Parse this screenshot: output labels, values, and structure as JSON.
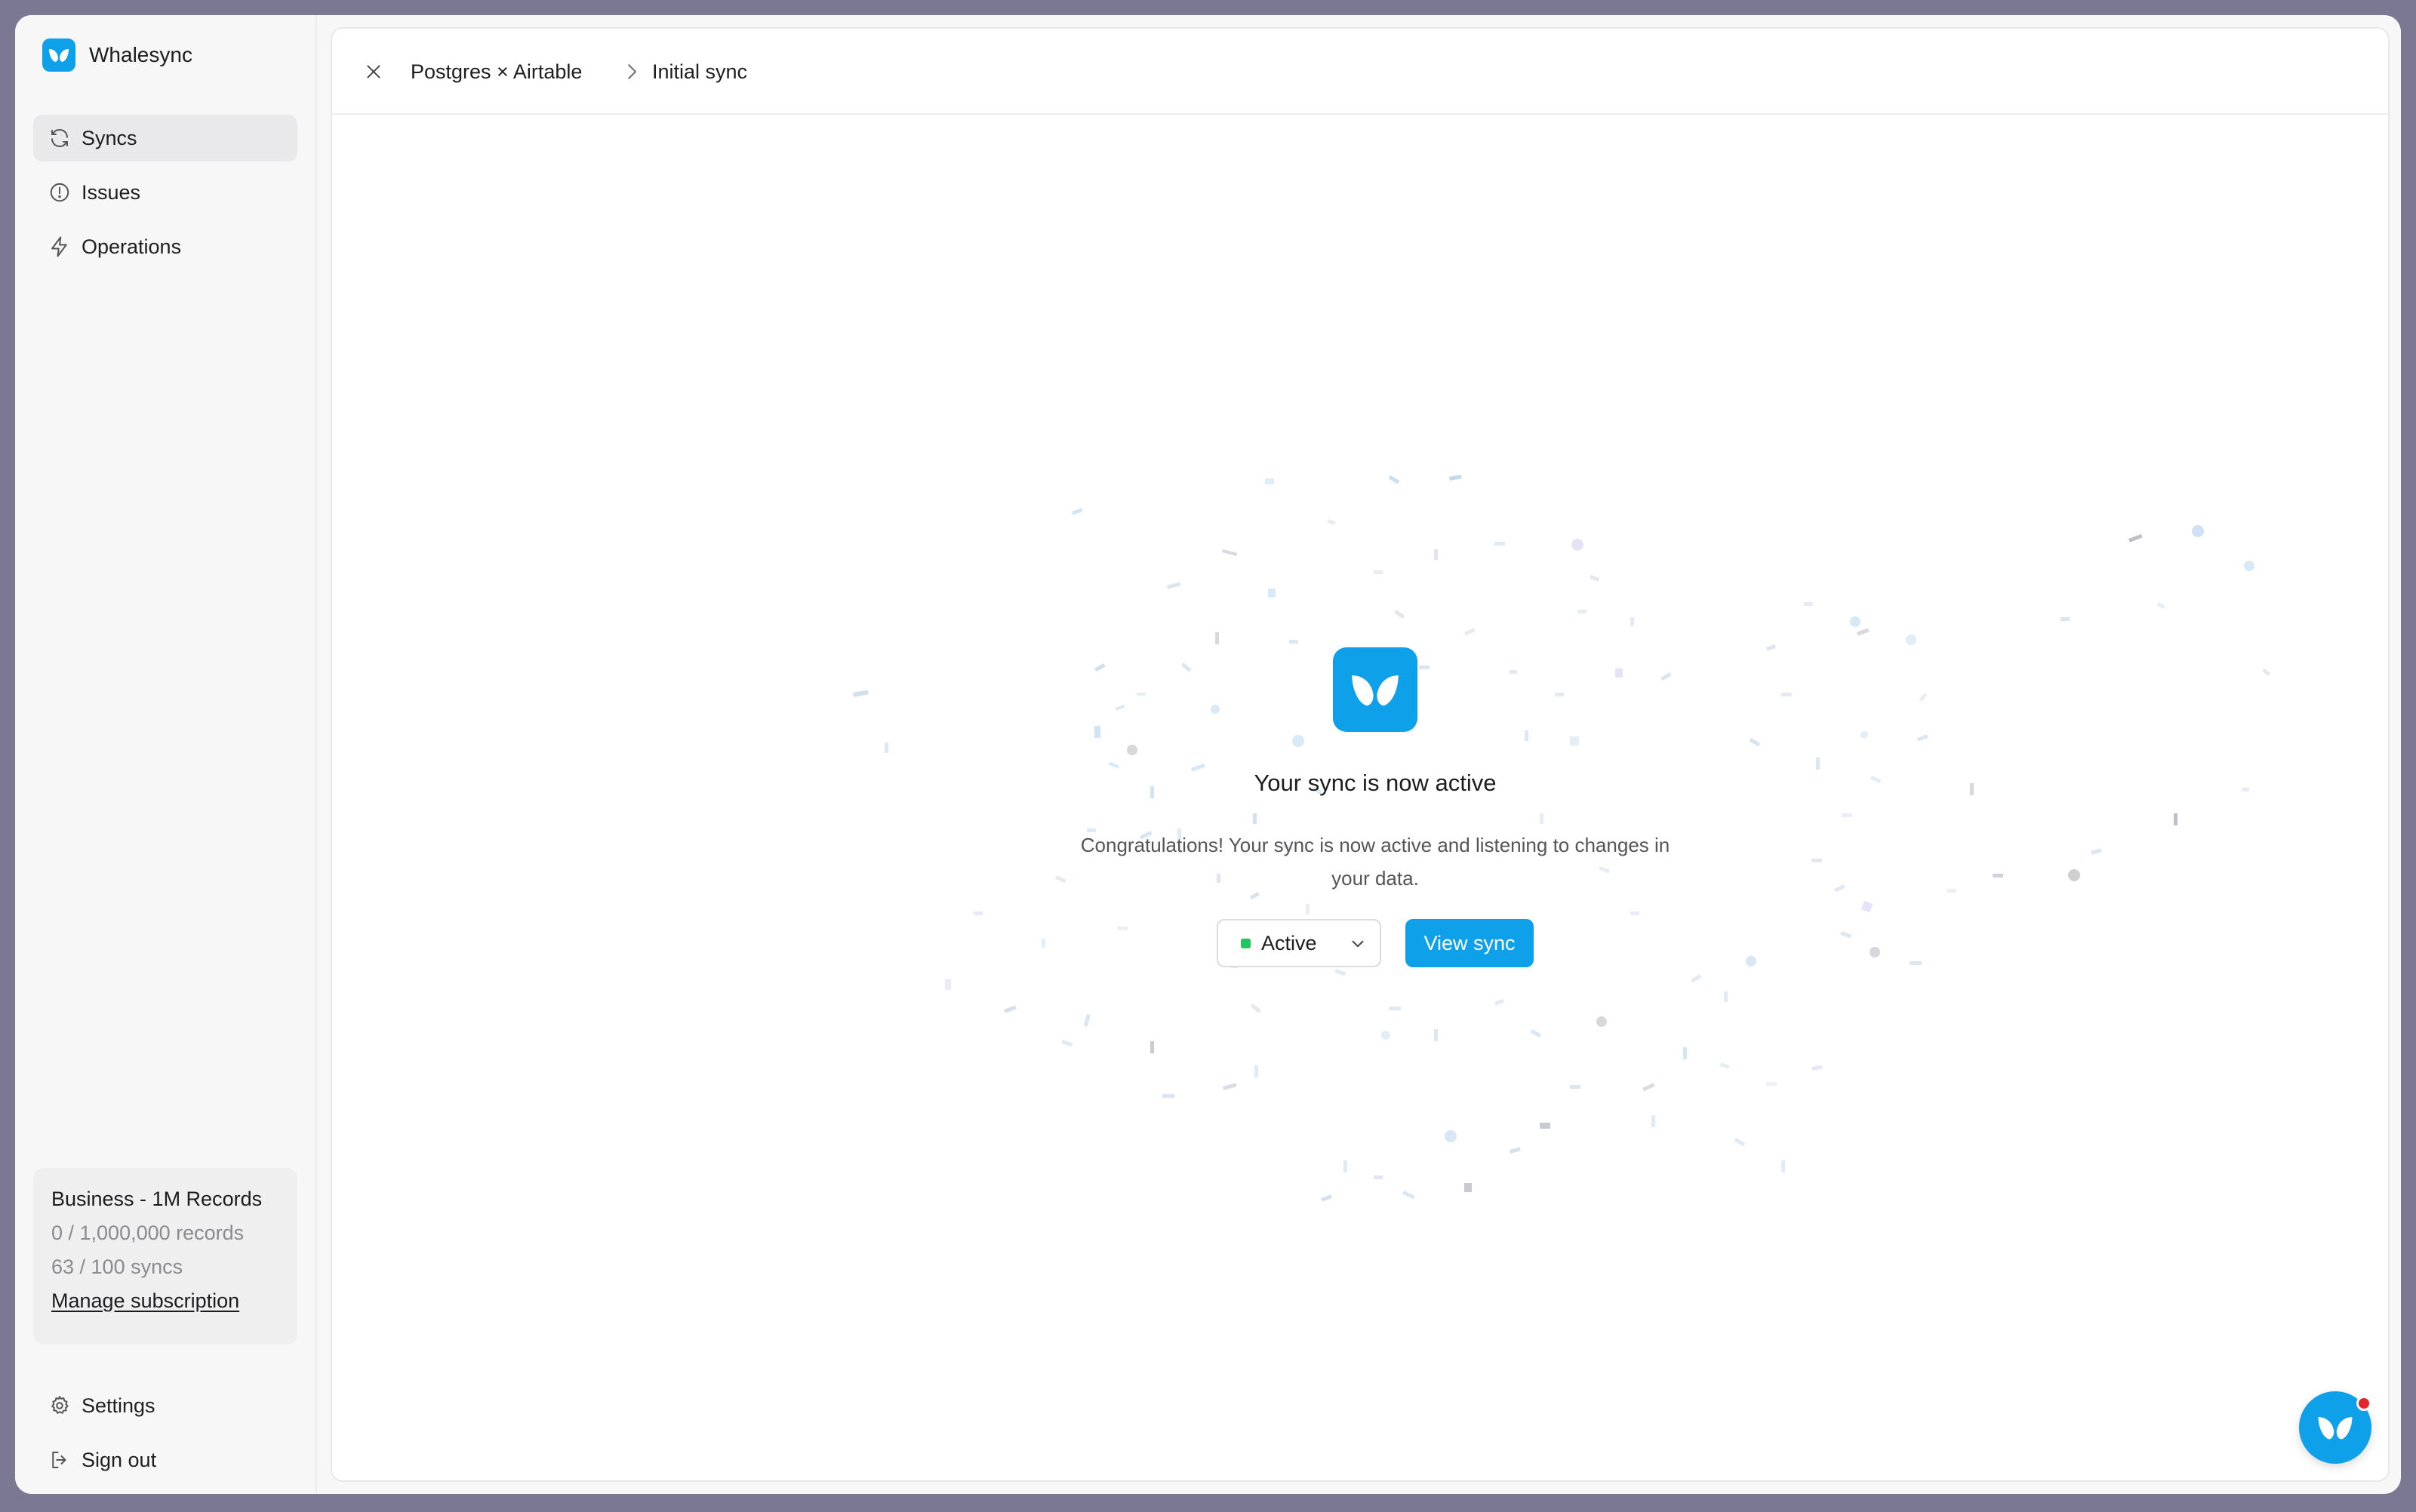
{
  "app": {
    "name": "Whalesync",
    "brand_color": "#0ea0e8"
  },
  "sidebar": {
    "items": [
      {
        "label": "Syncs",
        "icon": "refresh-icon",
        "active": true
      },
      {
        "label": "Issues",
        "icon": "alert-circle-icon",
        "active": false
      },
      {
        "label": "Operations",
        "icon": "lightning-icon",
        "active": false
      }
    ],
    "plan": {
      "title": "Business - 1M Records",
      "records": "0 / 1,000,000 records",
      "syncs": "63 / 100 syncs",
      "manage_label": "Manage subscription"
    },
    "bottom": [
      {
        "label": "Settings",
        "icon": "gear-icon"
      },
      {
        "label": "Sign out",
        "icon": "sign-out-icon"
      }
    ]
  },
  "header": {
    "breadcrumb": [
      "Postgres × Airtable",
      "Initial sync"
    ]
  },
  "main": {
    "title": "Your sync is now active",
    "description": "Congratulations! Your sync is now active and listening to changes in your data.",
    "status": {
      "value": "Active",
      "color": "#22c55e"
    },
    "primary_button": "View sync"
  }
}
